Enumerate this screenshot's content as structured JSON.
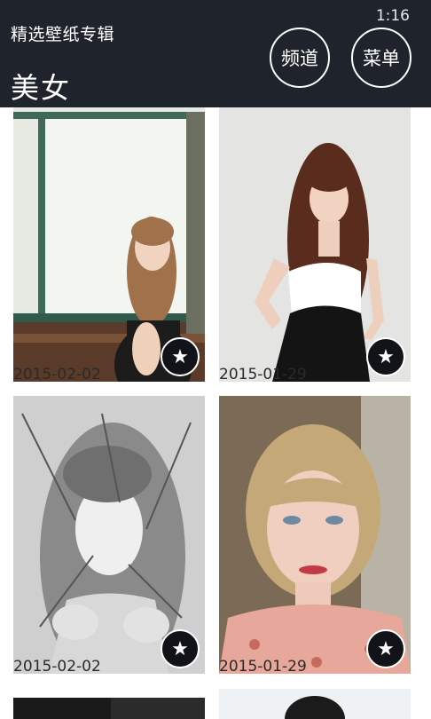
{
  "status": {
    "time": "1:16"
  },
  "header": {
    "app_title": "精选壁纸专辑",
    "page_title": "美女",
    "channel_button": "频道",
    "menu_button": "菜单"
  },
  "wallpapers": [
    {
      "date": "2015-02-02"
    },
    {
      "date": "2015-01-29"
    },
    {
      "date": "2015-02-02"
    },
    {
      "date": "2015-01-29"
    }
  ],
  "icons": {
    "favorite": "star-icon"
  },
  "colors": {
    "header_bg": "#1f232b",
    "star_button_bg": "#111318"
  }
}
